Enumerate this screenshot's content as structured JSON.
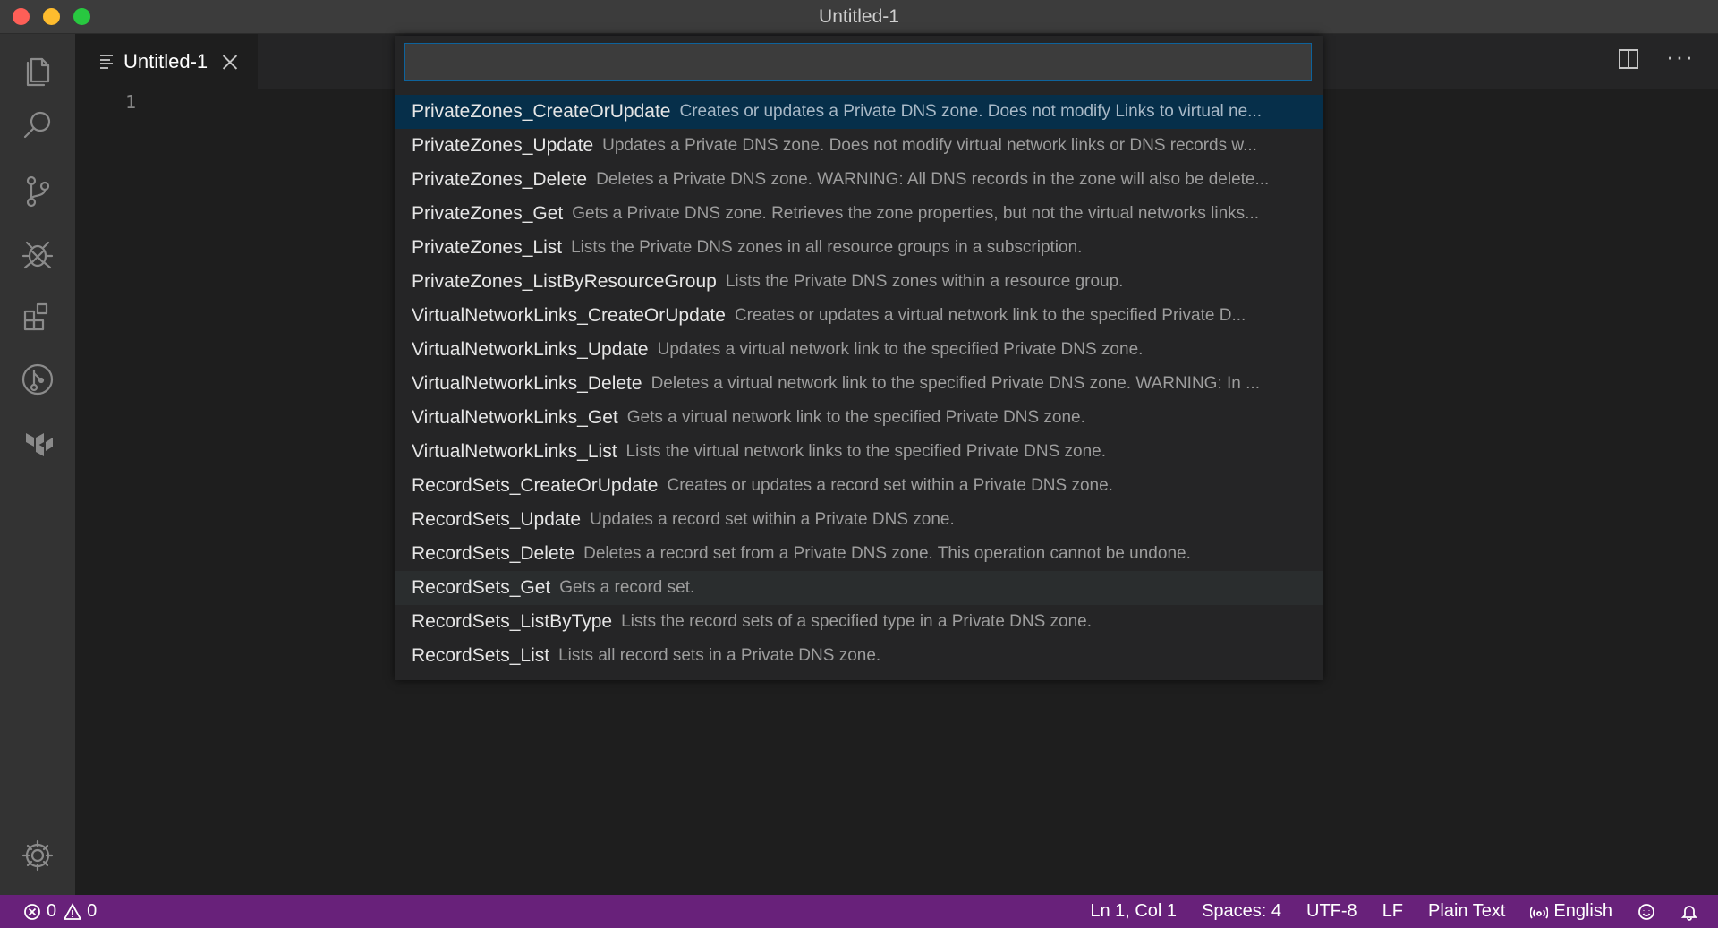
{
  "window": {
    "title": "Untitled-1"
  },
  "activity_bar": {
    "items": [
      {
        "icon": "files-icon"
      },
      {
        "icon": "search-icon"
      },
      {
        "icon": "source-control-icon"
      },
      {
        "icon": "debug-icon"
      },
      {
        "icon": "extensions-icon"
      },
      {
        "icon": "timeline-icon"
      },
      {
        "icon": "terraform-icon"
      }
    ],
    "settings_icon": "gear-icon"
  },
  "tabs": [
    {
      "label": "Untitled-1",
      "active": true
    }
  ],
  "editor": {
    "line_numbers": [
      "1"
    ]
  },
  "quick_pick": {
    "input_value": "",
    "selected_index": 0,
    "hover_index": 14,
    "items": [
      {
        "name": "PrivateZones_CreateOrUpdate",
        "description": "Creates or updates a Private DNS zone. Does not modify Links to virtual ne..."
      },
      {
        "name": "PrivateZones_Update",
        "description": "Updates a Private DNS zone. Does not modify virtual network links or DNS records w..."
      },
      {
        "name": "PrivateZones_Delete",
        "description": "Deletes a Private DNS zone. WARNING: All DNS records in the zone will also be delete..."
      },
      {
        "name": "PrivateZones_Get",
        "description": "Gets a Private DNS zone. Retrieves the zone properties, but not the virtual networks links..."
      },
      {
        "name": "PrivateZones_List",
        "description": "Lists the Private DNS zones in all resource groups in a subscription."
      },
      {
        "name": "PrivateZones_ListByResourceGroup",
        "description": "Lists the Private DNS zones within a resource group."
      },
      {
        "name": "VirtualNetworkLinks_CreateOrUpdate",
        "description": "Creates or updates a virtual network link to the specified Private D..."
      },
      {
        "name": "VirtualNetworkLinks_Update",
        "description": "Updates a virtual network link to the specified Private DNS zone."
      },
      {
        "name": "VirtualNetworkLinks_Delete",
        "description": "Deletes a virtual network link to the specified Private DNS zone. WARNING: In ..."
      },
      {
        "name": "VirtualNetworkLinks_Get",
        "description": "Gets a virtual network link to the specified Private DNS zone."
      },
      {
        "name": "VirtualNetworkLinks_List",
        "description": "Lists the virtual network links to the specified Private DNS zone."
      },
      {
        "name": "RecordSets_CreateOrUpdate",
        "description": "Creates or updates a record set within a Private DNS zone."
      },
      {
        "name": "RecordSets_Update",
        "description": "Updates a record set within a Private DNS zone."
      },
      {
        "name": "RecordSets_Delete",
        "description": "Deletes a record set from a Private DNS zone. This operation cannot be undone."
      },
      {
        "name": "RecordSets_Get",
        "description": "Gets a record set."
      },
      {
        "name": "RecordSets_ListByType",
        "description": "Lists the record sets of a specified type in a Private DNS zone."
      },
      {
        "name": "RecordSets_List",
        "description": "Lists all record sets in a Private DNS zone."
      }
    ]
  },
  "status_bar": {
    "errors": "0",
    "warnings": "0",
    "position": "Ln 1, Col 1",
    "spaces": "Spaces: 4",
    "encoding": "UTF-8",
    "eol": "LF",
    "language": "Plain Text",
    "spell_language": "English",
    "background": "#68217a"
  },
  "colors": {
    "selection": "#062f4a",
    "focus_border": "#0e639c"
  }
}
